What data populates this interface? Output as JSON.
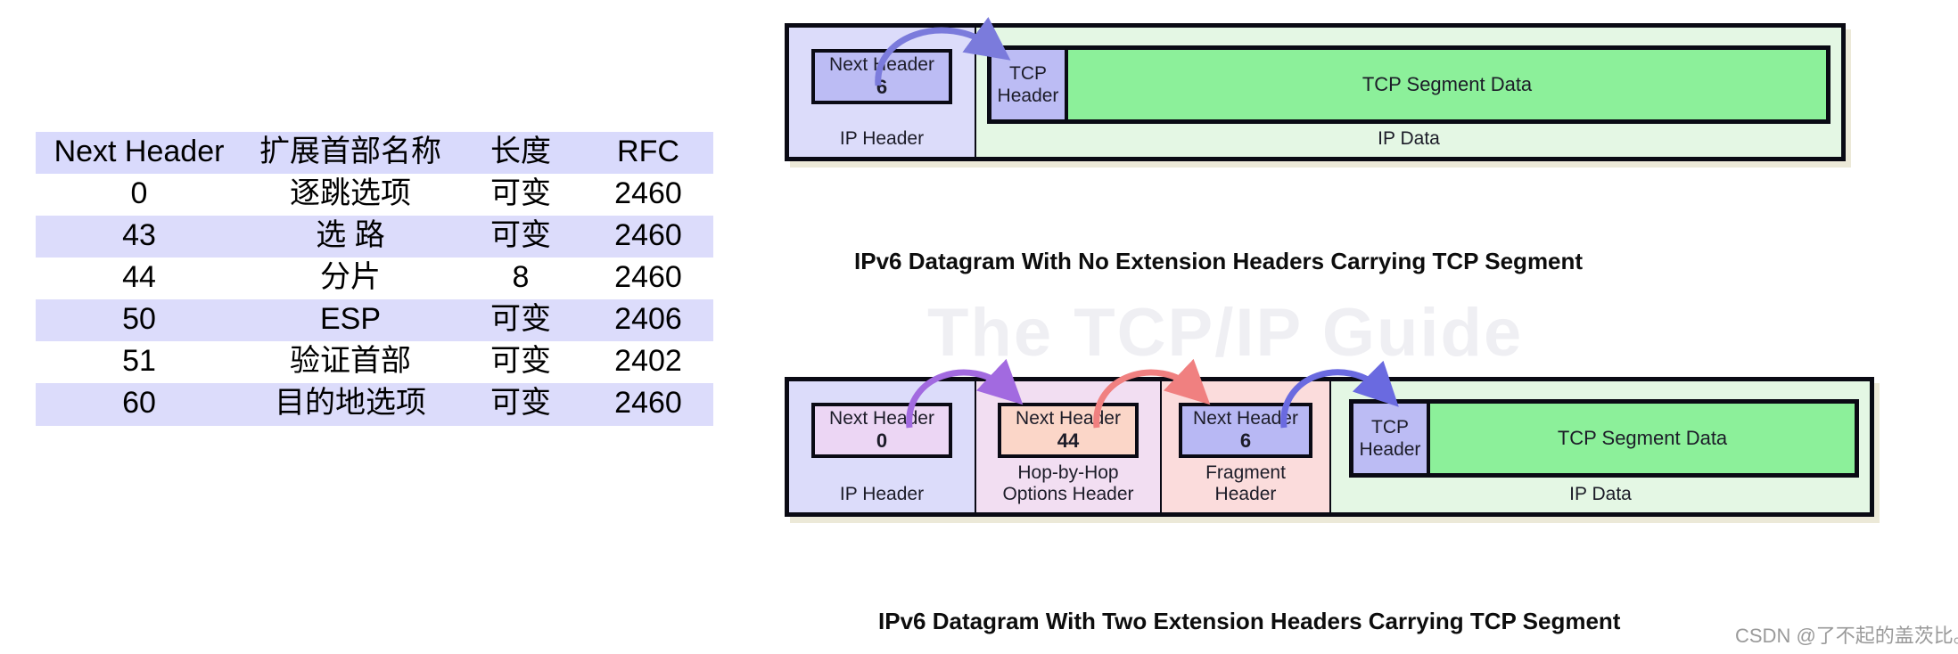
{
  "table": {
    "columns": [
      "Next Header",
      "扩展首部名称",
      "长度",
      "RFC"
    ],
    "rows": [
      {
        "next_header": "0",
        "name": "逐跳选项",
        "length": "可变",
        "rfc": "2460",
        "highlight": false
      },
      {
        "next_header": "43",
        "name": "选 路",
        "length": "可变",
        "rfc": "2460",
        "highlight": false
      },
      {
        "next_header": "44",
        "name": "分片",
        "length": "8",
        "rfc": "2460",
        "highlight": true
      },
      {
        "next_header": "50",
        "name": "ESP",
        "length": "可变",
        "rfc": "2406",
        "highlight": false
      },
      {
        "next_header": "51",
        "name": "验证首部",
        "length": "可变",
        "rfc": "2402",
        "highlight": false
      },
      {
        "next_header": "60",
        "name": "目的地选项",
        "length": "可变",
        "rfc": "2460",
        "highlight": false
      }
    ],
    "header_bg": "#d9dafc",
    "alt_row_bg": "#dcdcfb",
    "highlight_color": "#fe0000"
  },
  "watermarks": {
    "guide": "The TCP/IP Guide",
    "csdn": "CSDN @了不起的盖茨比。"
  },
  "diagram_top": {
    "caption": "IPv6 Datagram With No Extension Headers Carrying TCP Segment",
    "ip_header": {
      "label": "IP Header",
      "next_header_label": "Next Header",
      "next_header_value": "6"
    },
    "ip_data": {
      "label": "IP Data",
      "tcp_header_line1": "TCP",
      "tcp_header_line2": "Header",
      "tcp_data_label": "TCP Segment Data"
    },
    "arrow_color": "#7b7bdc"
  },
  "diagram_bottom": {
    "caption": "IPv6 Datagram With Two Extension Headers Carrying TCP Segment",
    "segments": [
      {
        "label_line1": "",
        "label_line2": "IP Header",
        "next_header_label": "Next Header",
        "next_header_value": "0"
      },
      {
        "label_line1": "Hop-by-Hop",
        "label_line2": "Options Header",
        "next_header_label": "Next Header",
        "next_header_value": "44"
      },
      {
        "label_line1": "Fragment",
        "label_line2": "Header",
        "next_header_label": "Next Header",
        "next_header_value": "6"
      }
    ],
    "ip_data": {
      "label": "IP Data",
      "tcp_header_line1": "TCP",
      "tcp_header_line2": "Header",
      "tcp_data_label": "TCP Segment Data"
    },
    "arrow_colors": [
      "#a26ae0",
      "#f08080",
      "#6a6ae0"
    ]
  }
}
